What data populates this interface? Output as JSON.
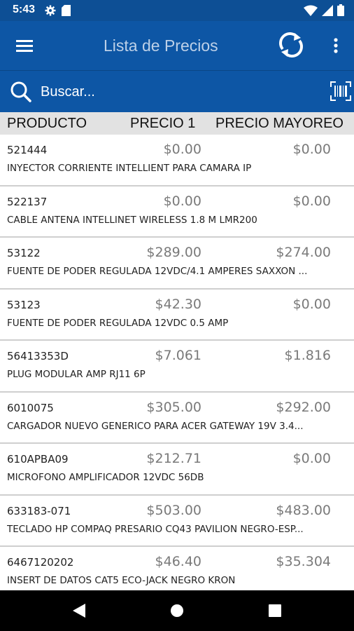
{
  "status_bar": {
    "time": "5:43",
    "icons_left": [
      "gear-icon",
      "sd-card-icon"
    ],
    "icons_right": [
      "wifi-icon",
      "cell-signal-icon",
      "battery-icon"
    ]
  },
  "app_bar": {
    "title": "Lista de Precios",
    "background": "#0d56a5",
    "icons": [
      "menu-icon",
      "sync-icon",
      "overflow-menu-icon"
    ]
  },
  "search": {
    "placeholder": "Buscar...",
    "value": "",
    "icons": [
      "search-icon",
      "barcode-scan-icon"
    ]
  },
  "table": {
    "headers": {
      "product": "PRODUCTO",
      "price1": "PRECIO 1",
      "wholesale": "PRECIO MAYOREO"
    },
    "rows": [
      {
        "code": "521444",
        "price1": "$0.00",
        "wholesale": "$0.00",
        "description": "INYECTOR CORRIENTE INTELLIENT PARA CAMARA IP"
      },
      {
        "code": "522137",
        "price1": "$0.00",
        "wholesale": "$0.00",
        "description": "CABLE ANTENA INTELLINET WIRELESS 1.8 M LMR200"
      },
      {
        "code": "53122",
        "price1": "$289.00",
        "wholesale": "$274.00",
        "description": "FUENTE DE PODER REGULADA 12VDC/4.1 AMPERES SAXXON ..."
      },
      {
        "code": "53123",
        "price1": "$42.30",
        "wholesale": "$0.00",
        "description": "FUENTE DE PODER REGULADA 12VDC 0.5 AMP"
      },
      {
        "code": "56413353D",
        "price1": "$7.061",
        "wholesale": "$1.816",
        "description": "PLUG MODULAR AMP RJ11 6P"
      },
      {
        "code": "6010075",
        "price1": "$305.00",
        "wholesale": "$292.00",
        "description": "CARGADOR NUEVO GENERICO PARA ACER GATEWAY 19V 3.4..."
      },
      {
        "code": "610APBA09",
        "price1": "$212.71",
        "wholesale": "$0.00",
        "description": "MICROFONO AMPLIFICADOR 12VDC 56DB"
      },
      {
        "code": "633183-071",
        "price1": "$503.00",
        "wholesale": "$483.00",
        "description": "TECLADO HP COMPAQ PRESARIO CQ43 PAVILION NEGRO-ESP..."
      },
      {
        "code": "6467120202",
        "price1": "$46.40",
        "wholesale": "$35.304",
        "description": "INSERT DE DATOS CAT5 ECO-JACK NEGRO KRON"
      }
    ]
  },
  "nav_bar": {
    "icons": [
      "back-icon",
      "home-icon",
      "recent-apps-icon"
    ]
  }
}
